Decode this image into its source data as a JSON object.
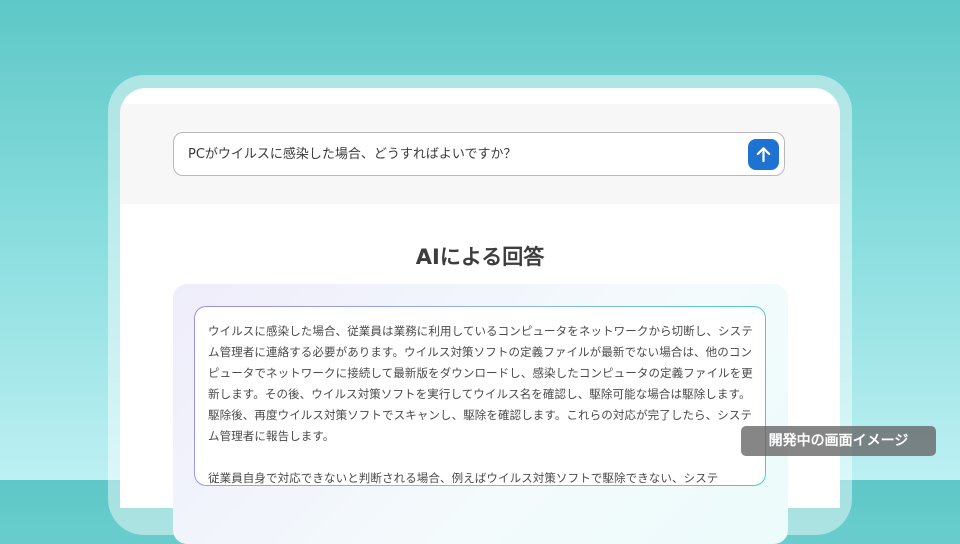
{
  "search": {
    "query": "PCがウイルスに感染した場合、どうすればよいですか？"
  },
  "answer": {
    "title": "AIによる回答",
    "paragraphs": [
      "ウイルスに感染した場合、従業員は業務に利用しているコンピュータをネットワークから切断し、システム管理者に連絡する必要があります。ウイルス対策ソフトの定義ファイルが最新でない場合は、他のコンピュータでネットワークに接続して最新版をダウンロードし、感染したコンピュータの定義ファイルを更新します。その後、ウイルス対策ソフトを実行してウイルス名を確認し、駆除可能な場合は駆除します。駆除後、再度ウイルス対策ソフトでスキャンし、駆除を確認します。これらの対応が完了したら、システム管理者に報告します。",
      "従業員自身で対応できないと判断される場合、例えばウイルス対策ソフトで駆除できない、システ"
    ]
  },
  "badge": {
    "label": "開発中の画面イメージ"
  },
  "colors": {
    "send_button": "#1e73d2",
    "background_top": "#5ec7c7",
    "background_bottom": "#bdf0f3"
  },
  "icons": {
    "send": "arrow-up-icon"
  }
}
